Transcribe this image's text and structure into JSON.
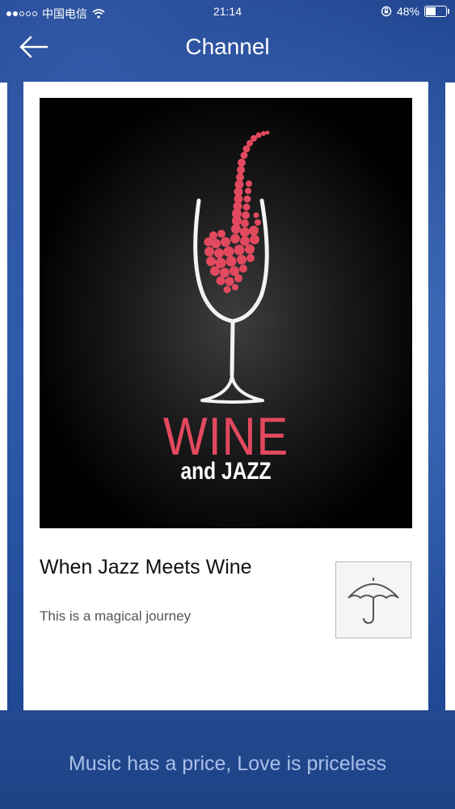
{
  "status_bar": {
    "carrier": "中国电信",
    "time": "21:14",
    "battery": "48%",
    "battery_level": 0.48
  },
  "nav": {
    "title": "Channel",
    "back_icon": "arrow-left-icon"
  },
  "card": {
    "artwork": {
      "title_big": "WINE",
      "title_small": "and JAZZ"
    },
    "title": "When Jazz Meets Wine",
    "subtitle": "This is a magical journey",
    "action_icon": "umbrella-icon"
  },
  "footer": {
    "slogan": "Music has a price, Love is priceless"
  },
  "colors": {
    "accent_red": "#e2495f",
    "background_blue": "#2554a4"
  }
}
